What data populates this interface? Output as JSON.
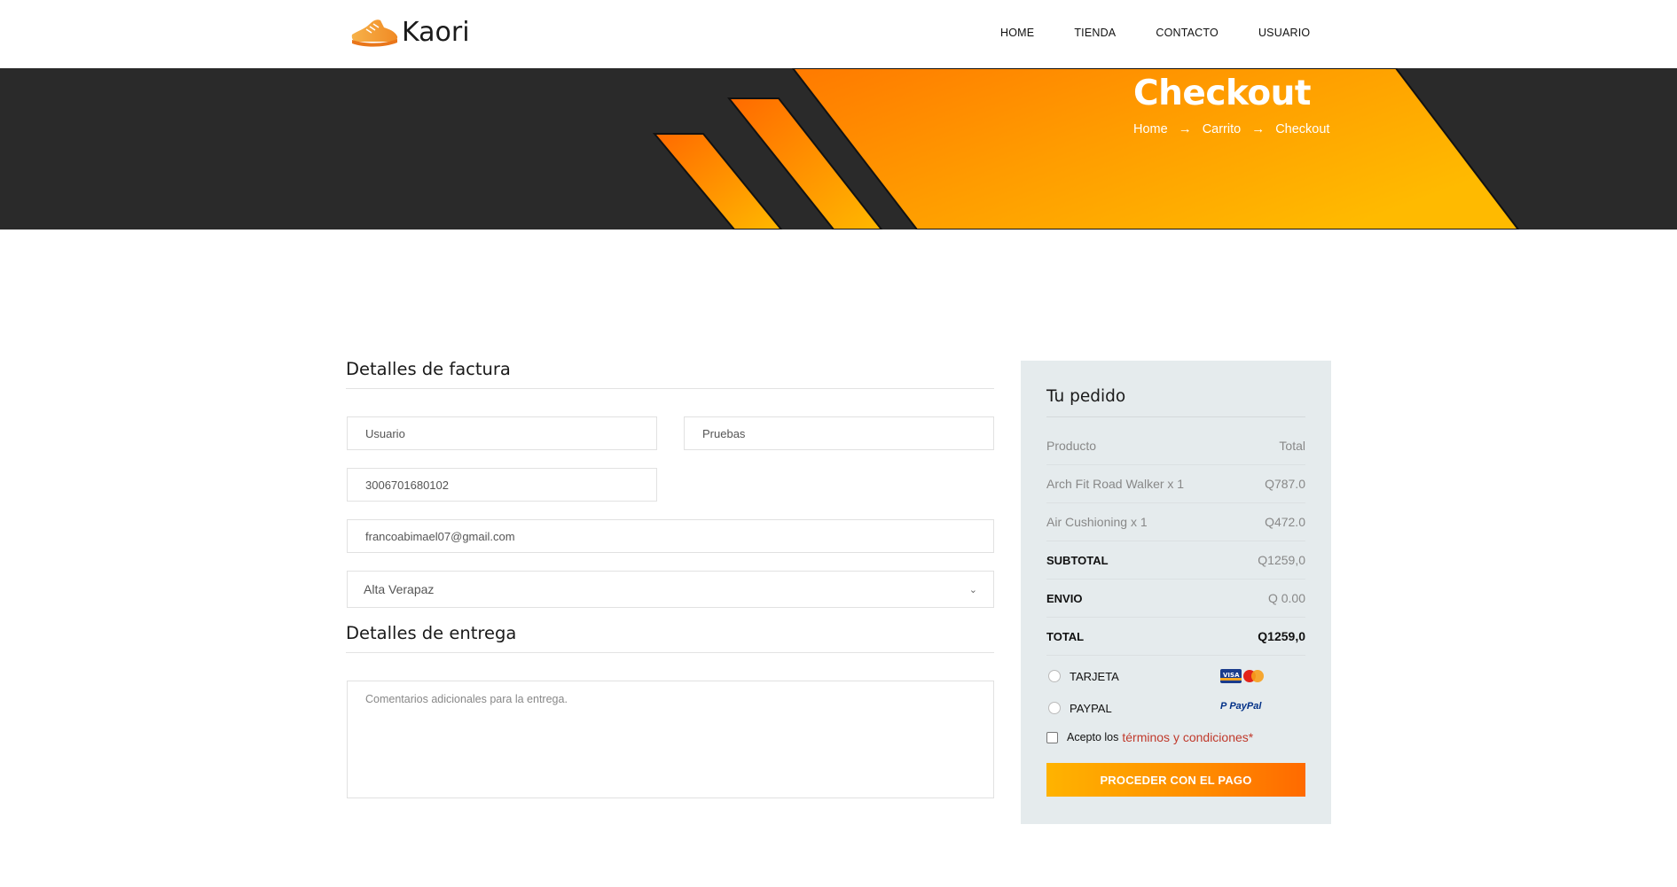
{
  "brand": {
    "name": "Kaori"
  },
  "nav": [
    "HOME",
    "TIENDA",
    "CONTACTO",
    "USUARIO"
  ],
  "hero": {
    "title": "Checkout",
    "breadcrumb": [
      "Home",
      "Carrito",
      "Checkout"
    ]
  },
  "billing": {
    "title": "Detalles de factura",
    "first_name": "Usuario",
    "last_name": "Pruebas",
    "nit": "3006701680102",
    "email": "francoabimael07@gmail.com",
    "department": "Alta Verapaz"
  },
  "delivery": {
    "title": "Detalles de entrega",
    "comments_placeholder": "Comentarios adicionales para la entrega."
  },
  "order": {
    "title": "Tu pedido",
    "col_product": "Producto",
    "col_total": "Total",
    "items": [
      {
        "name": "Arch Fit Road Walker x 1",
        "price": "Q787.0"
      },
      {
        "name": "Air Cushioning x 1",
        "price": "Q472.0"
      }
    ],
    "subtotal_label": "SUBTOTAL",
    "subtotal": "Q1259,0",
    "shipping_label": "ENVIO",
    "shipping": "Q 0.00",
    "total_label": "TOTAL",
    "total": "Q1259,0",
    "pay_card": "TARJETA",
    "pay_paypal": "PAYPAL",
    "paypal_logo": "PayPal",
    "terms_prefix": "Acepto los",
    "terms_link": "términos y condiciones*",
    "proceed": "PROCEDER CON EL PAGO"
  },
  "colors": {
    "accent_orange": "#ff8c00",
    "accent_yellow": "#ffb300",
    "dark": "#2a2a2a",
    "panel": "#e5ebed",
    "link_red": "#c0392b"
  }
}
